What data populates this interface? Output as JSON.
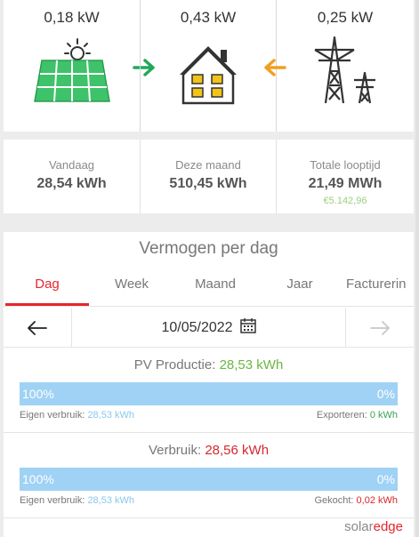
{
  "flow": {
    "pv_power": "0,18 kW",
    "load_power": "0,43 kW",
    "grid_power": "0,25 kW",
    "icons": [
      "solar-panel-icon",
      "house-icon",
      "power-pylon-icon"
    ],
    "colors": {
      "solar": "#3ec26a",
      "pv_arrow": "#22a85a",
      "grid_arrow": "#f0a020",
      "house_window": "#f2c318"
    }
  },
  "stats": {
    "today_label": "Vandaag",
    "today_value": "28,54 kWh",
    "month_label": "Deze maand",
    "month_value": "510,45 kWh",
    "lifetime_label": "Totale looptijd",
    "lifetime_value": "21,49 MWh",
    "lifetime_revenue": "€5.142,96"
  },
  "daily": {
    "title": "Vermogen per dag",
    "tabs": [
      "Dag",
      "Week",
      "Maand",
      "Jaar",
      "Facturerin"
    ],
    "active_tab": "Dag",
    "date": "10/05/2022",
    "production": {
      "label": "PV Productie: ",
      "value": "28,53 kWh",
      "bar_left": "100%",
      "bar_right": "0%",
      "self_use_label": "Eigen verbruik: ",
      "self_use_value": "28,53 kWh",
      "export_label": "Exporteren: ",
      "export_value": "0 kWh"
    },
    "consumption": {
      "label": "Verbruik: ",
      "value": "28,56 kWh",
      "bar_left": "100%",
      "bar_right": "0%",
      "self_use_label": "Eigen verbruik: ",
      "self_use_value": "28,53 kWh",
      "bought_label": "Gekocht: ",
      "bought_value": "0,02 kWh"
    }
  },
  "brand": {
    "part1": "solar",
    "part2": "edge"
  }
}
